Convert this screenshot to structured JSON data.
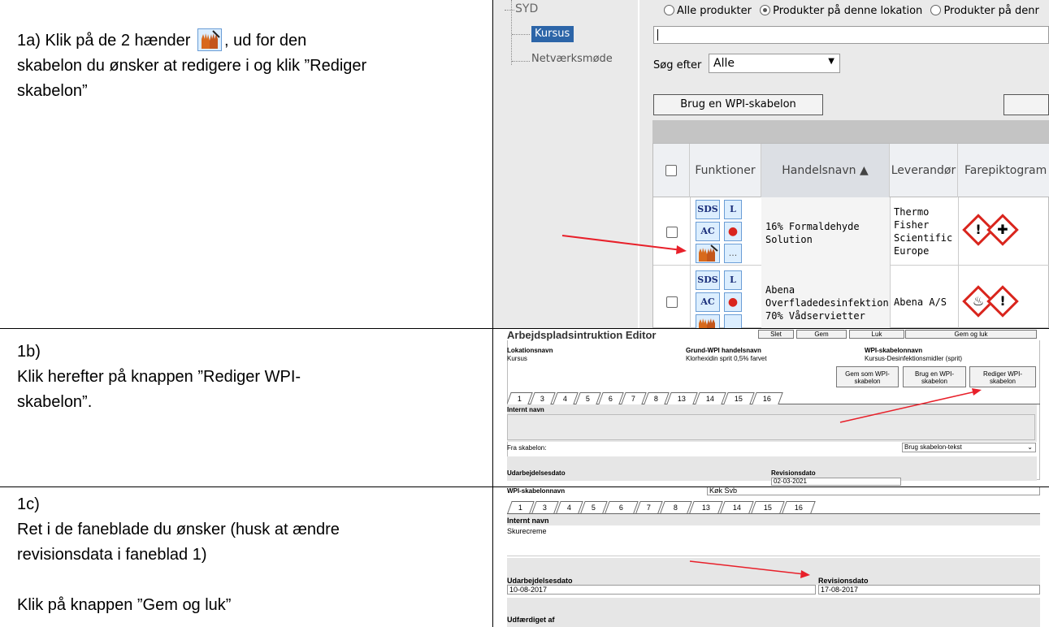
{
  "steps": {
    "s1a_prefix": "1a) Klik på de 2 hænder",
    "s1a_rest": ", ud for den",
    "s1a_line2": "skabelon du ønsker at redigere i og klik ”Rediger",
    "s1a_line3": "skabelon”",
    "s1b_line1": "1b)",
    "s1b_line2": "Klik herefter på knappen ”Rediger WPI-",
    "s1b_line3": "skabelon”.",
    "s1c_line1": "1c)",
    "s1c_line2": "Ret i de faneblade du ønsker (husk at ændre",
    "s1c_line3": "revisionsdata i faneblad 1)",
    "s1c_line4": "Klik på knappen ”Gem og luk”"
  },
  "shot1": {
    "tree": {
      "root": "SYD",
      "item1": "Kursus",
      "item2": "Netværksmøde"
    },
    "radios": [
      "Alle produkter",
      "Produkter på denne lokation",
      "Produkter på denr"
    ],
    "search_label": "Søg efter",
    "search_select": "Alle",
    "wpi_button": "Brug en WPI-skabelon",
    "columns": {
      "funktioner": "Funktioner",
      "handelsnavn": "Handelsnavn ▲",
      "leverandor": "Leverandør",
      "farepiktogram": "Farepiktogram"
    },
    "icons": {
      "sds": "SDS",
      "l": "L",
      "ac": "AC",
      "more": "..."
    },
    "rows": [
      {
        "name_l1": "16% Formaldehyde",
        "name_l2": "Solution",
        "supplier_l1": "Thermo",
        "supplier_l2": "Fisher",
        "supplier_l3": "Scientific",
        "supplier_l4": "Europe"
      },
      {
        "name_l1": "Abena",
        "name_l2": "Overfladedesinfektion",
        "name_l3": "70% Vådservietter",
        "supplier_l1": "Abena A/S"
      }
    ],
    "arrow_color": "#e8202a"
  },
  "shot2": {
    "title": "Arbejdspladsintruktion Editor",
    "top_buttons": [
      "Slet",
      "Gem",
      "Luk",
      "Gem og luk"
    ],
    "labels": {
      "lokation": "Lokationsnavn",
      "grund": "Grund-WPI handelsnavn",
      "wpinavn": "WPI-skabelonnavn"
    },
    "values": {
      "lokation": "Kursus",
      "grund": "Klorhexidin sprit 0,5% farvet",
      "wpinavn": "Kursus-Desinfektionsmidler (sprit)"
    },
    "buttons": {
      "gem_l1": "Gem som WPI-",
      "gem_l2": "skabelon",
      "brug_l1": "Brug en WPI-",
      "brug_l2": "skabelon",
      "rediger_l1": "Rediger WPI-",
      "rediger_l2": "skabelon"
    },
    "tabs": [
      "1",
      "3",
      "4",
      "5",
      "6",
      "7",
      "8",
      "13",
      "14",
      "15",
      "16"
    ],
    "internt_navn": "Internt navn",
    "fra_skabelon": "Fra skabelon:",
    "fra_select": "Brug skabelon-tekst",
    "udarbejdelsesdato": "Udarbejdelsesdato",
    "revisionsdato": "Revisionsdato",
    "rev_value": "02-03-2021"
  },
  "shot3": {
    "wpi_label": "WPI-skabelonnavn",
    "wpi_value": "Køk Svb",
    "tabs": [
      "1",
      "3",
      "4",
      "5",
      "6",
      "7",
      "8",
      "13",
      "14",
      "15",
      "16"
    ],
    "internt_navn": "Internt navn",
    "internt_value": "Skurecreme",
    "udarbejdelsesdato": "Udarbejdelsesdato",
    "ud_value": "10-08-2017",
    "revisionsdato": "Revisionsdato",
    "rev_value": "17-08-2017",
    "udfaerdiget": "Udfærdiget af"
  }
}
